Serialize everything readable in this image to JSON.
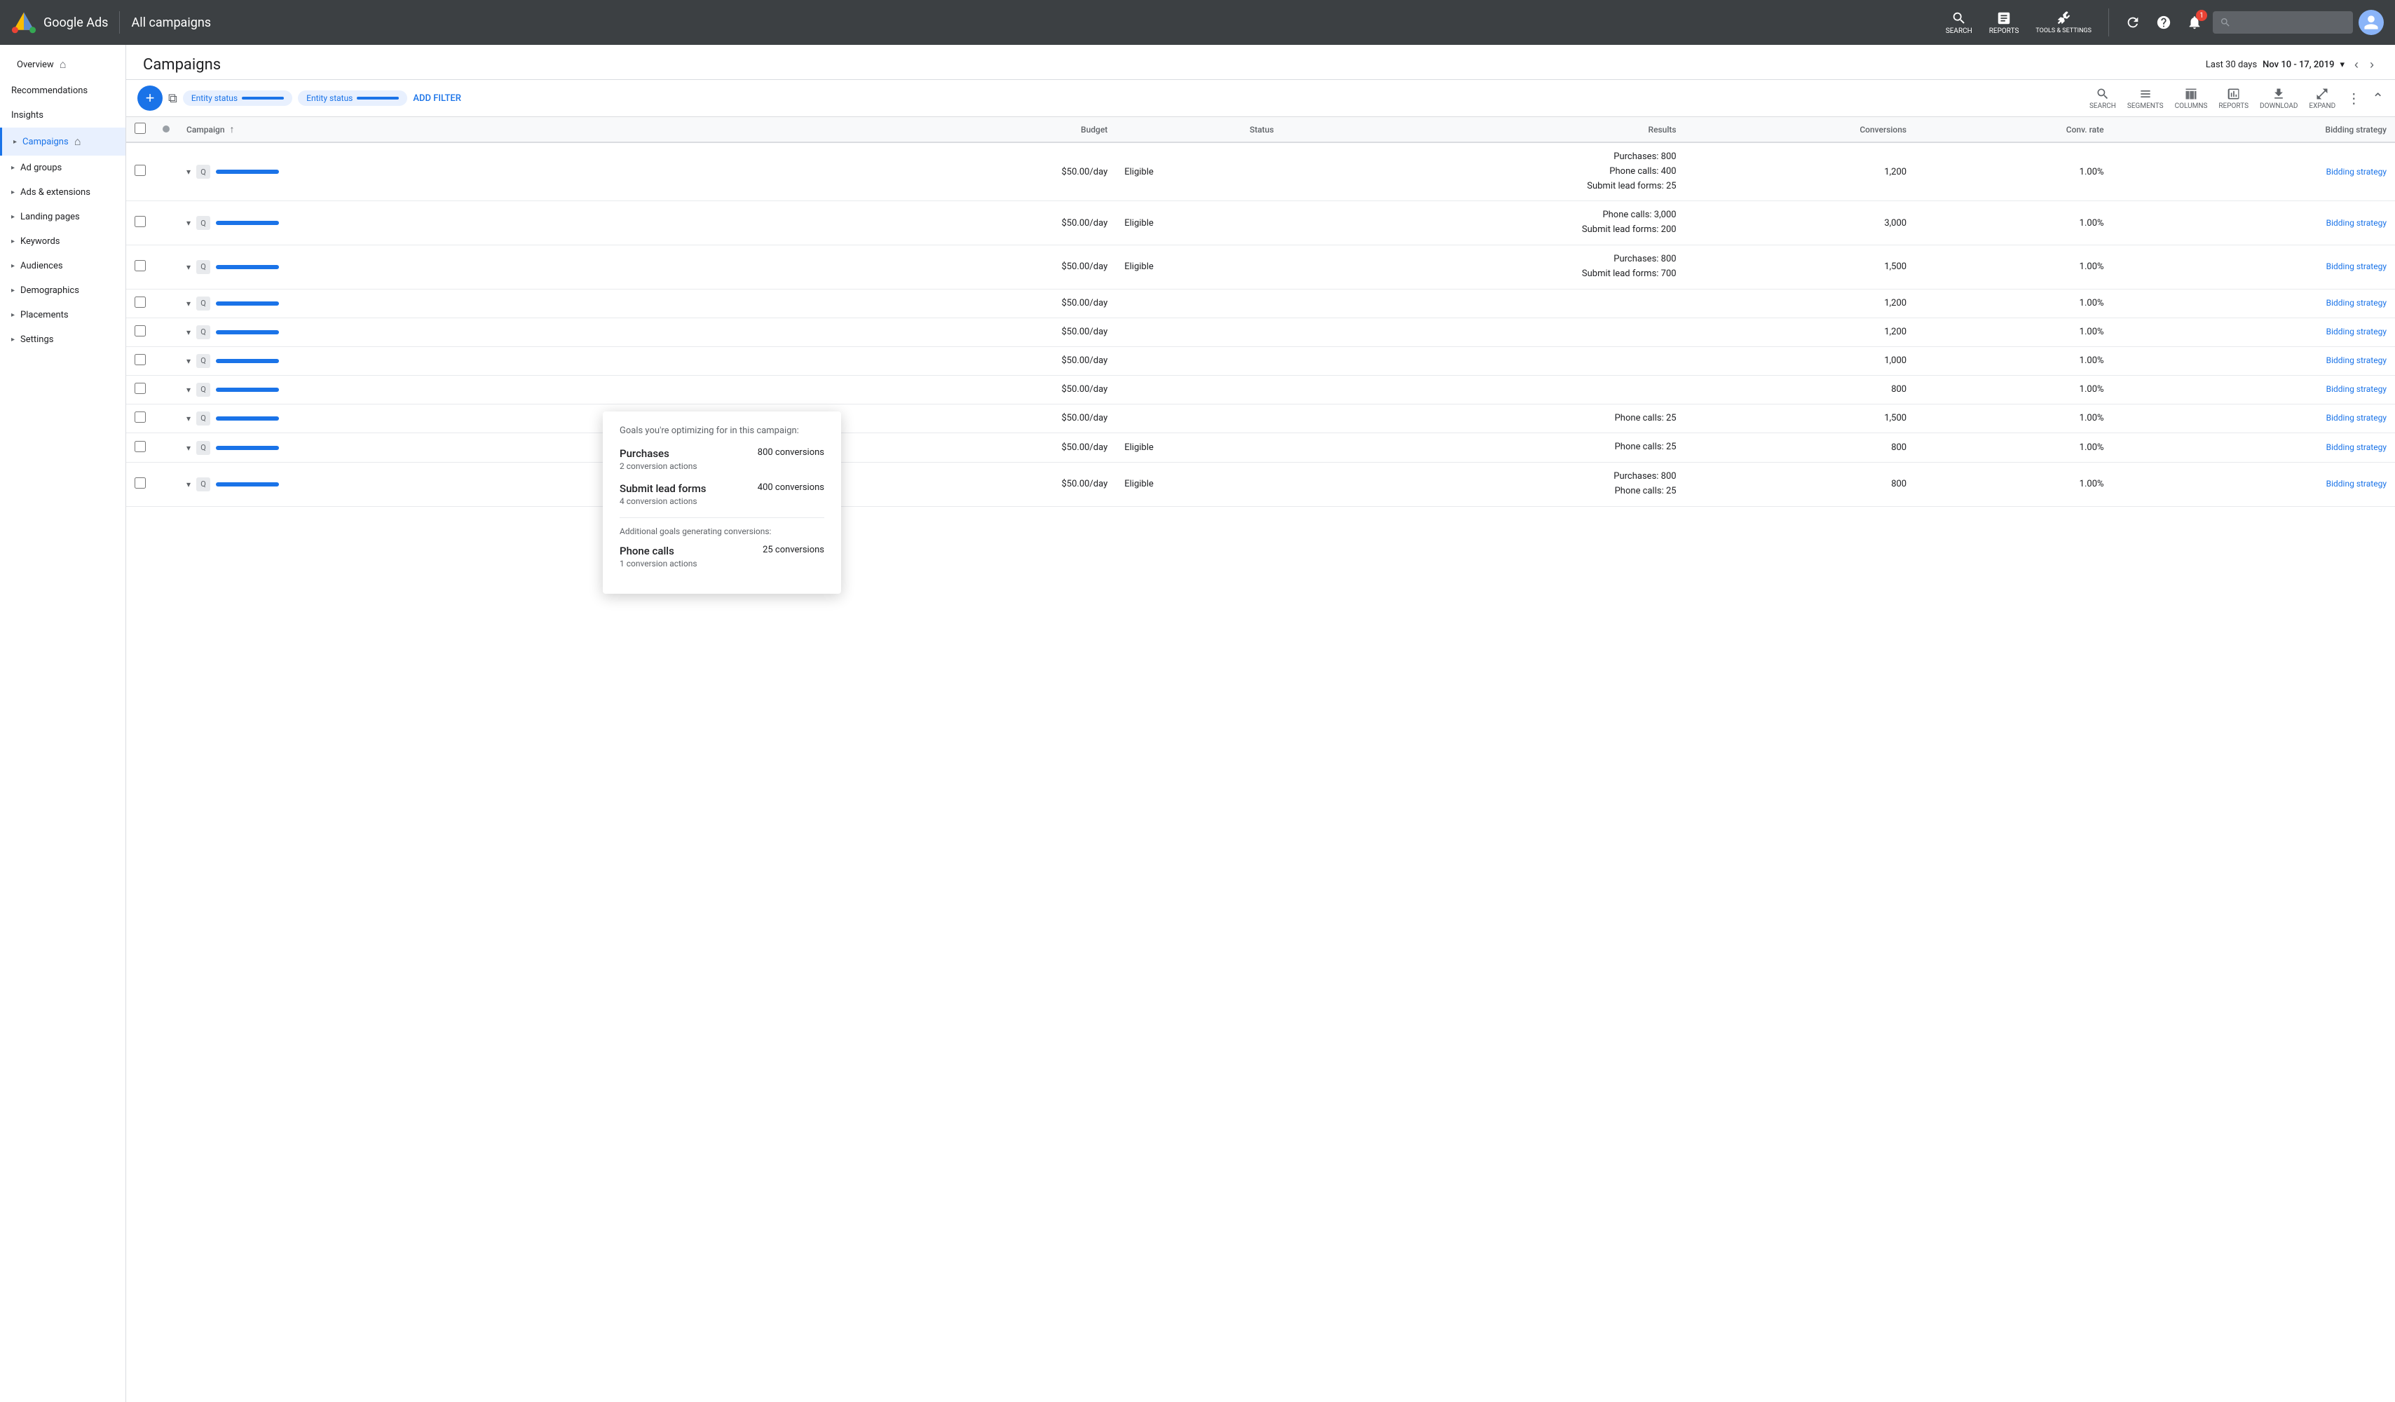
{
  "app": {
    "name": "Google Ads",
    "page_title": "All campaigns"
  },
  "topnav": {
    "search_label": "SEARCH",
    "reports_label": "REPORTS",
    "tools_label": "TOOLS & SETTINGS",
    "notification_count": "1"
  },
  "header": {
    "title": "Campaigns",
    "date_range_label": "Last 30 days",
    "date_range_value": "Nov 10 - 17, 2019"
  },
  "filter_bar": {
    "entity_status_1": "Entity status",
    "entity_status_2": "Entity status",
    "add_filter": "ADD FILTER",
    "search_label": "SEARCH",
    "segments_label": "SEGMENTS",
    "columns_label": "COLUMNS",
    "reports_label": "REPORTS",
    "download_label": "DOWNLOAD",
    "expand_label": "EXPAND"
  },
  "table": {
    "columns": [
      "Campaign",
      "Budget",
      "Status",
      "Results",
      "Conversions",
      "Conv. rate",
      "Bidding strategy"
    ],
    "rows": [
      {
        "budget": "$50.00/day",
        "status": "Eligible",
        "results": [
          "Purchases: 800",
          "Phone calls: 400",
          "Submit lead forms: 25"
        ],
        "conversions": "1,200",
        "conv_rate": "1.00%",
        "bidding": "Bidding strategy"
      },
      {
        "budget": "$50.00/day",
        "status": "Eligible",
        "results": [
          "Phone calls: 3,000",
          "Submit lead forms: 200"
        ],
        "conversions": "3,000",
        "conv_rate": "1.00%",
        "bidding": "Bidding strategy"
      },
      {
        "budget": "$50.00/day",
        "status": "Eligible",
        "results": [
          "Purchases: 800",
          "Submit lead forms: 700"
        ],
        "conversions": "1,500",
        "conv_rate": "1.00%",
        "bidding": "Bidding strategy"
      },
      {
        "budget": "$50.00/day",
        "status": "",
        "results": [],
        "conversions": "1,200",
        "conv_rate": "1.00%",
        "bidding": "Bidding strategy"
      },
      {
        "budget": "$50.00/day",
        "status": "",
        "results": [],
        "conversions": "1,200",
        "conv_rate": "1.00%",
        "bidding": "Bidding strategy"
      },
      {
        "budget": "$50.00/day",
        "status": "",
        "results": [],
        "conversions": "1,000",
        "conv_rate": "1.00%",
        "bidding": "Bidding strategy"
      },
      {
        "budget": "$50.00/day",
        "status": "",
        "results": [],
        "conversions": "800",
        "conv_rate": "1.00%",
        "bidding": "Bidding strategy"
      },
      {
        "budget": "$50.00/day",
        "status": "",
        "results": [
          "Phone calls: 25"
        ],
        "conversions": "1,500",
        "conv_rate": "1.00%",
        "bidding": "Bidding strategy"
      },
      {
        "budget": "$50.00/day",
        "status": "Eligible",
        "results": [
          "Phone calls: 25"
        ],
        "conversions": "800",
        "conv_rate": "1.00%",
        "bidding": "Bidding strategy"
      },
      {
        "budget": "$50.00/day",
        "status": "Eligible",
        "results": [
          "Purchases: 800",
          "Phone calls: 25"
        ],
        "conversions": "800",
        "conv_rate": "1.00%",
        "bidding": "Bidding strategy"
      }
    ]
  },
  "sidebar": {
    "items": [
      {
        "label": "Overview",
        "has_home": true,
        "active": false
      },
      {
        "label": "Recommendations",
        "active": false
      },
      {
        "label": "Insights",
        "active": false
      },
      {
        "label": "Campaigns",
        "has_home": true,
        "active": true
      },
      {
        "label": "Ad groups",
        "active": false
      },
      {
        "label": "Ads & extensions",
        "active": false
      },
      {
        "label": "Landing pages",
        "active": false
      },
      {
        "label": "Keywords",
        "active": false
      },
      {
        "label": "Audiences",
        "active": false
      },
      {
        "label": "Demographics",
        "active": false
      },
      {
        "label": "Placements",
        "active": false
      },
      {
        "label": "Settings",
        "active": false
      }
    ]
  },
  "tooltip": {
    "header": "Goals you're optimizing for in this campaign:",
    "goals": [
      {
        "name": "Purchases",
        "conversions": "800 conversions",
        "actions": "2 conversion actions"
      },
      {
        "name": "Submit lead forms",
        "conversions": "400 conversions",
        "actions": "4 conversion actions"
      }
    ],
    "additional_header": "Additional goals generating conversions:",
    "additional_goals": [
      {
        "name": "Phone calls",
        "conversions": "25 conversions",
        "actions": "1 conversion actions"
      }
    ]
  }
}
